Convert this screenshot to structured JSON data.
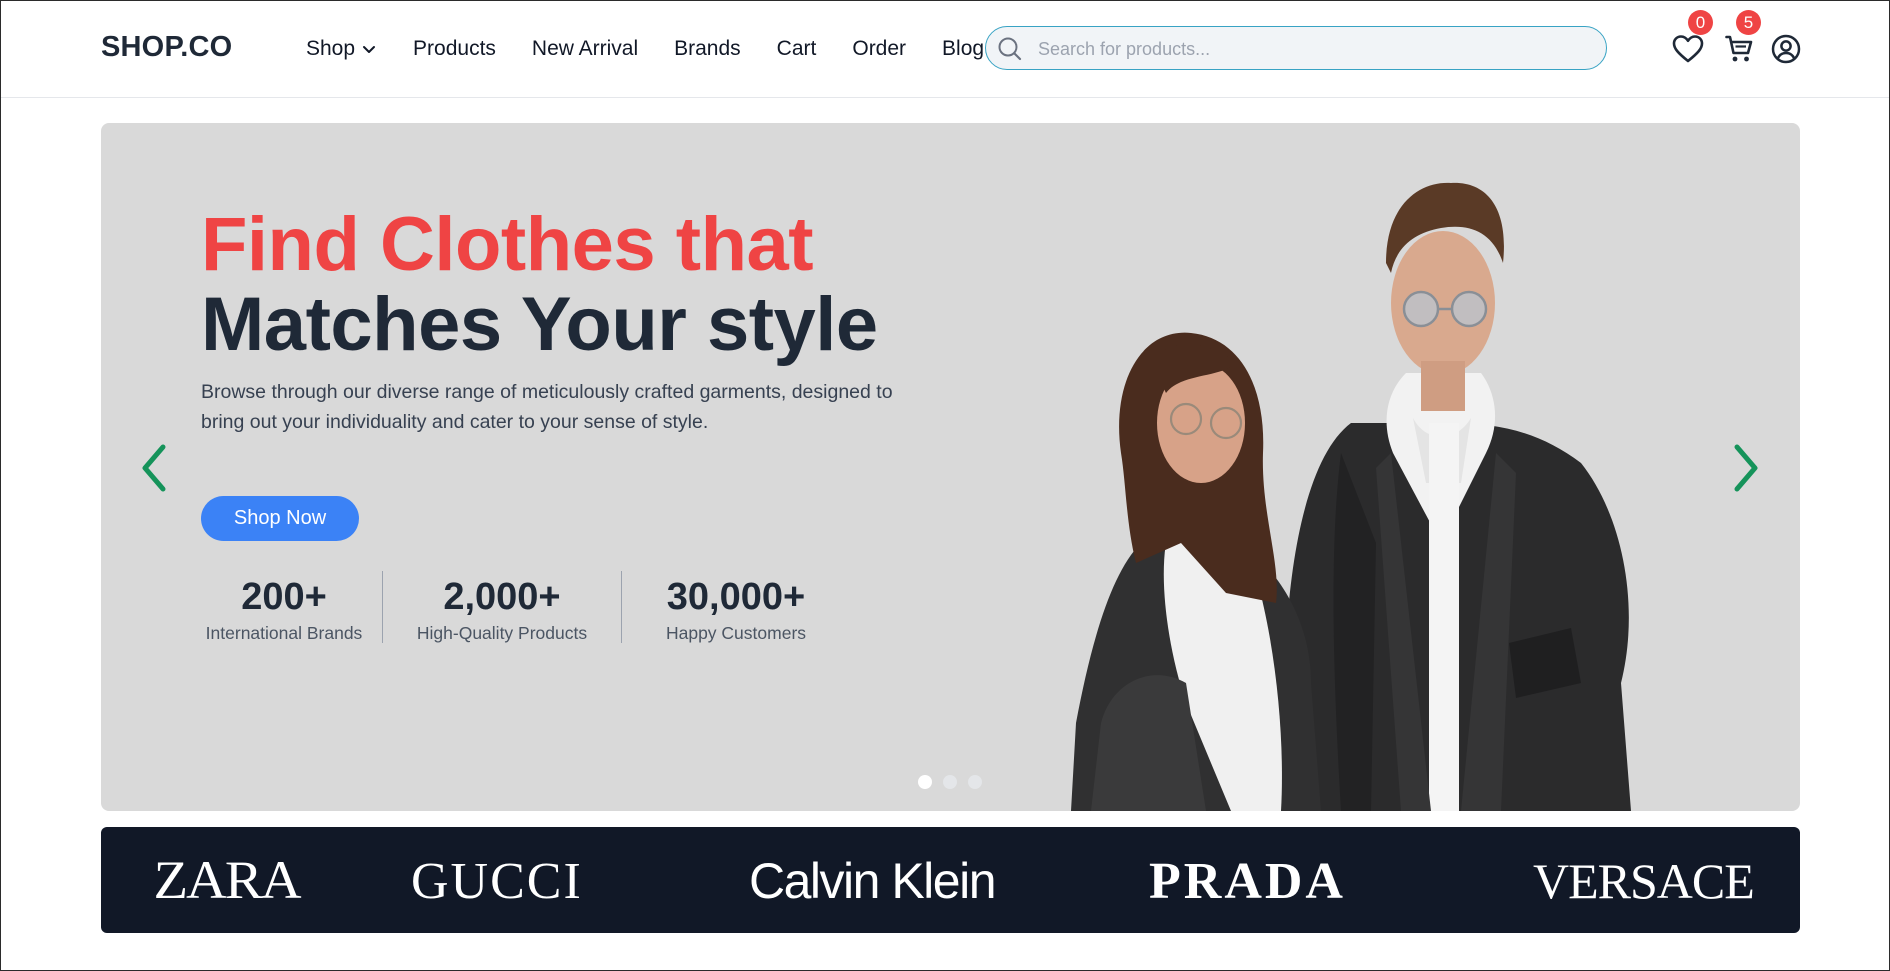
{
  "header": {
    "logo": "SHOP.CO",
    "nav": [
      {
        "label": "Shop",
        "has_dropdown": true
      },
      {
        "label": "Products"
      },
      {
        "label": "New Arrival"
      },
      {
        "label": "Brands"
      },
      {
        "label": "Cart"
      },
      {
        "label": "Order"
      },
      {
        "label": "Blog"
      }
    ],
    "search": {
      "placeholder": "Search for products...",
      "value": ""
    },
    "wishlist": {
      "icon": "heart-icon",
      "count": "0"
    },
    "cart": {
      "icon": "cart-icon",
      "count": "5"
    },
    "account": {
      "icon": "user-circle-icon"
    }
  },
  "hero": {
    "title_line1": "Find Clothes that",
    "title_line2": "Matches Your style",
    "description": "Browse through our diverse range of meticulously crafted garments, designed to bring out your individuality and cater to your sense of style.",
    "cta_label": "Shop Now",
    "stats": [
      {
        "value": "200+",
        "label": "International Brands"
      },
      {
        "value": "2,000+",
        "label": "High-Quality Products"
      },
      {
        "value": "30,000+",
        "label": "Happy Customers"
      }
    ],
    "carousel": {
      "slide_count": 3,
      "active_slide": 1,
      "prev_icon": "chevron-left-icon",
      "next_icon": "chevron-right-icon"
    }
  },
  "brands": [
    {
      "name": "ZARA"
    },
    {
      "name": "GUCCI"
    },
    {
      "name": "Calvin Klein"
    },
    {
      "name": "PRADA"
    },
    {
      "name": "VERSACE"
    }
  ],
  "colors": {
    "accent_red": "#ef4444",
    "heading_dark": "#1f2937",
    "primary_blue": "#3b82f6",
    "arrow_green": "#15935a",
    "brand_bar": "#111827",
    "hero_bg": "#d9d9d9",
    "search_border": "#38a3c4"
  }
}
